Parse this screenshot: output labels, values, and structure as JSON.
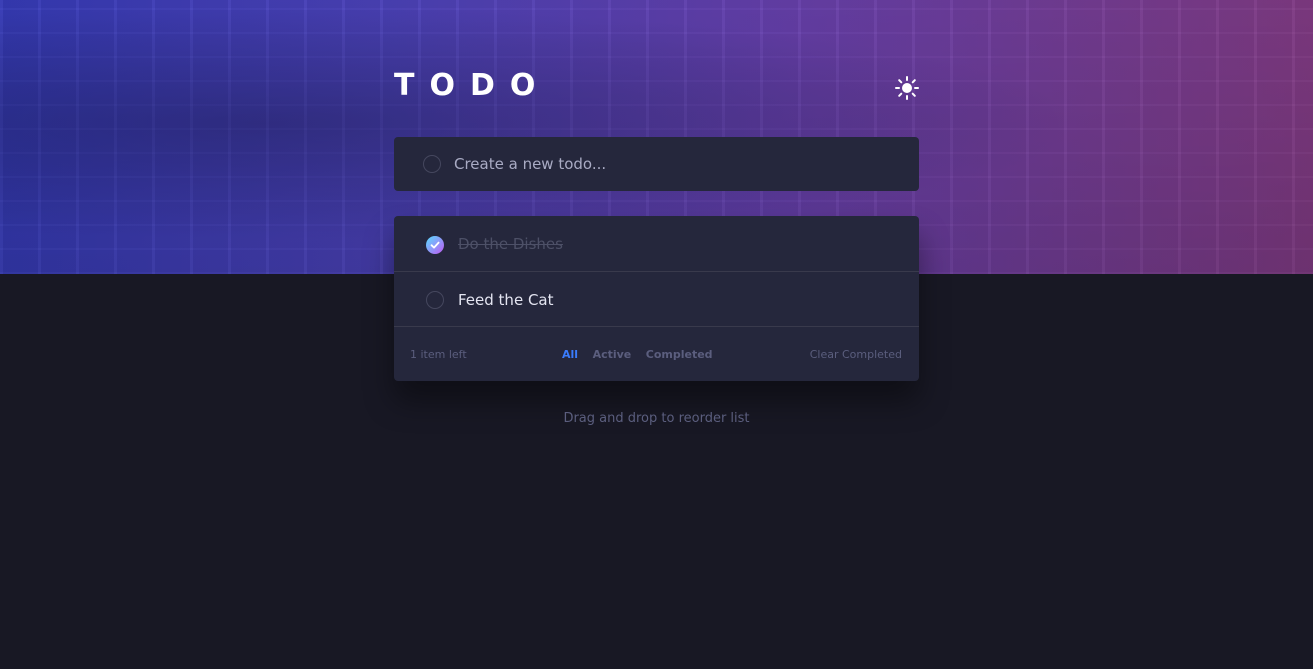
{
  "header": {
    "title": "TODO",
    "theme_icon": "sun-icon"
  },
  "new_todo": {
    "placeholder": "Create a new todo...",
    "value": ""
  },
  "todos": [
    {
      "text": "Do the Dishes",
      "completed": true
    },
    {
      "text": "Feed the Cat",
      "completed": false
    }
  ],
  "footer": {
    "items_left": "1 item left",
    "filters": [
      "All",
      "Active",
      "Completed"
    ],
    "selected_filter": "All",
    "clear_label": "Clear Completed"
  },
  "hint": "Drag and drop to reorder list",
  "colors": {
    "background": "#181824",
    "card": "#25273c",
    "accent": "#3a7cfd",
    "check_gradient_start": "#57ddff",
    "check_gradient_end": "#c058f3"
  }
}
